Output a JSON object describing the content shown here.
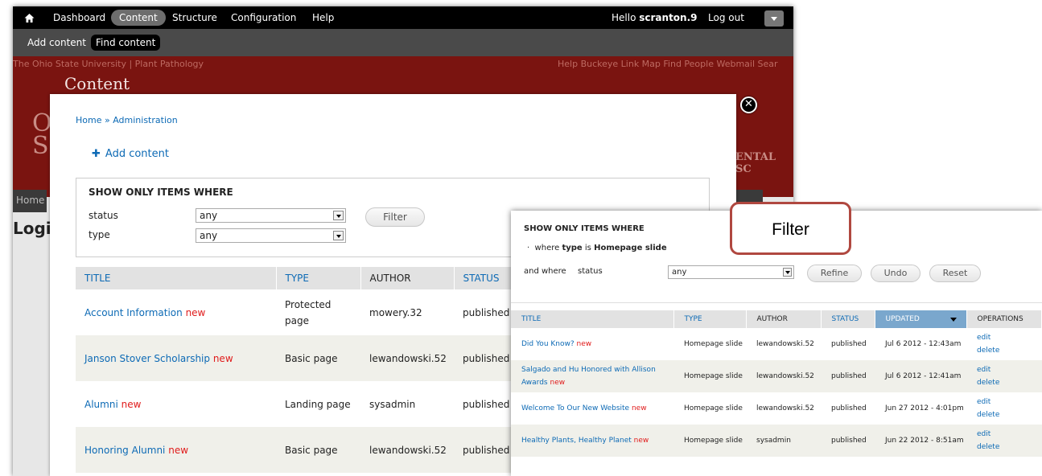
{
  "toolbar": {
    "items": [
      "Dashboard",
      "Content",
      "Structure",
      "Configuration",
      "Help"
    ],
    "active": "Content",
    "greeting": "Hello",
    "username": "scranton.9",
    "logout": "Log out"
  },
  "shortcuts": {
    "add": "Add content",
    "find": "Find content"
  },
  "site": {
    "links_left": "The Ohio State University  |  Plant Pathology",
    "links_right": "Help   Buckeye Link   Map   Find People   Webmail   Sear",
    "page_heading": "Content",
    "serif_fragment": "ENTAL SC",
    "home_tab": "Home",
    "login_fragment": "Logi"
  },
  "overlay": {
    "breadcrumb": "Home » Administration",
    "add_content": "Add content",
    "filter": {
      "heading": "SHOW ONLY ITEMS WHERE",
      "status_label": "status",
      "status_value": "any",
      "type_label": "type",
      "type_value": "any",
      "button": "Filter"
    },
    "table": {
      "headers": [
        "TITLE",
        "TYPE",
        "AUTHOR",
        "STATUS"
      ],
      "rows": [
        {
          "title": "Account Information",
          "flag": "new",
          "type": "Protected page",
          "author": "mowery.32",
          "status": "published"
        },
        {
          "title": "Janson Stover Scholarship",
          "flag": "new",
          "type": "Basic page",
          "author": "lewandowski.52",
          "status": "published"
        },
        {
          "title": "Alumni",
          "flag": "new",
          "type": "Landing page",
          "author": "sysadmin",
          "status": "published"
        },
        {
          "title": "Honoring Alumni",
          "flag": "new",
          "type": "Basic page",
          "author": "lewandowski.52",
          "status": "published"
        }
      ]
    }
  },
  "filtered": {
    "heading": "SHOW ONLY ITEMS WHERE",
    "where_prefix": "where",
    "where_field": "type",
    "where_is": "is",
    "where_value": "Homepage slide",
    "and_where": "and where",
    "status_label": "status",
    "status_value": "any",
    "buttons": {
      "refine": "Refine",
      "undo": "Undo",
      "reset": "Reset"
    },
    "table": {
      "headers": [
        "TITLE",
        "TYPE",
        "AUTHOR",
        "STATUS",
        "UPDATED",
        "OPERATIONS"
      ],
      "rows": [
        {
          "title": "Did You Know?",
          "flag": "new",
          "type": "Homepage slide",
          "author": "lewandowski.52",
          "status": "published",
          "updated": "Jul 6 2012 - 12:43am",
          "edit": "edit",
          "delete": "delete"
        },
        {
          "title": "Salgado and Hu Honored with Allison Awards",
          "flag": "new",
          "type": "Homepage slide",
          "author": "lewandowski.52",
          "status": "published",
          "updated": "Jul 6 2012 - 12:41am",
          "edit": "edit",
          "delete": "delete"
        },
        {
          "title": "Welcome To Our New Website",
          "flag": "new",
          "type": "Homepage slide",
          "author": "lewandowski.52",
          "status": "published",
          "updated": "Jun 27 2012 - 4:01pm",
          "edit": "edit",
          "delete": "delete"
        },
        {
          "title": "Healthy Plants, Healthy Planet",
          "flag": "new",
          "type": "Homepage slide",
          "author": "sysadmin",
          "status": "published",
          "updated": "Jun 22 2012 - 8:51am",
          "edit": "edit",
          "delete": "delete"
        }
      ]
    }
  },
  "callout": "Filter",
  "colors": {
    "link": "#0d6ab5",
    "new_flag": "#e01b1b",
    "site_red": "#7a1410",
    "callout_border": "#b04840",
    "sorted_header": "#7aa7cd"
  }
}
